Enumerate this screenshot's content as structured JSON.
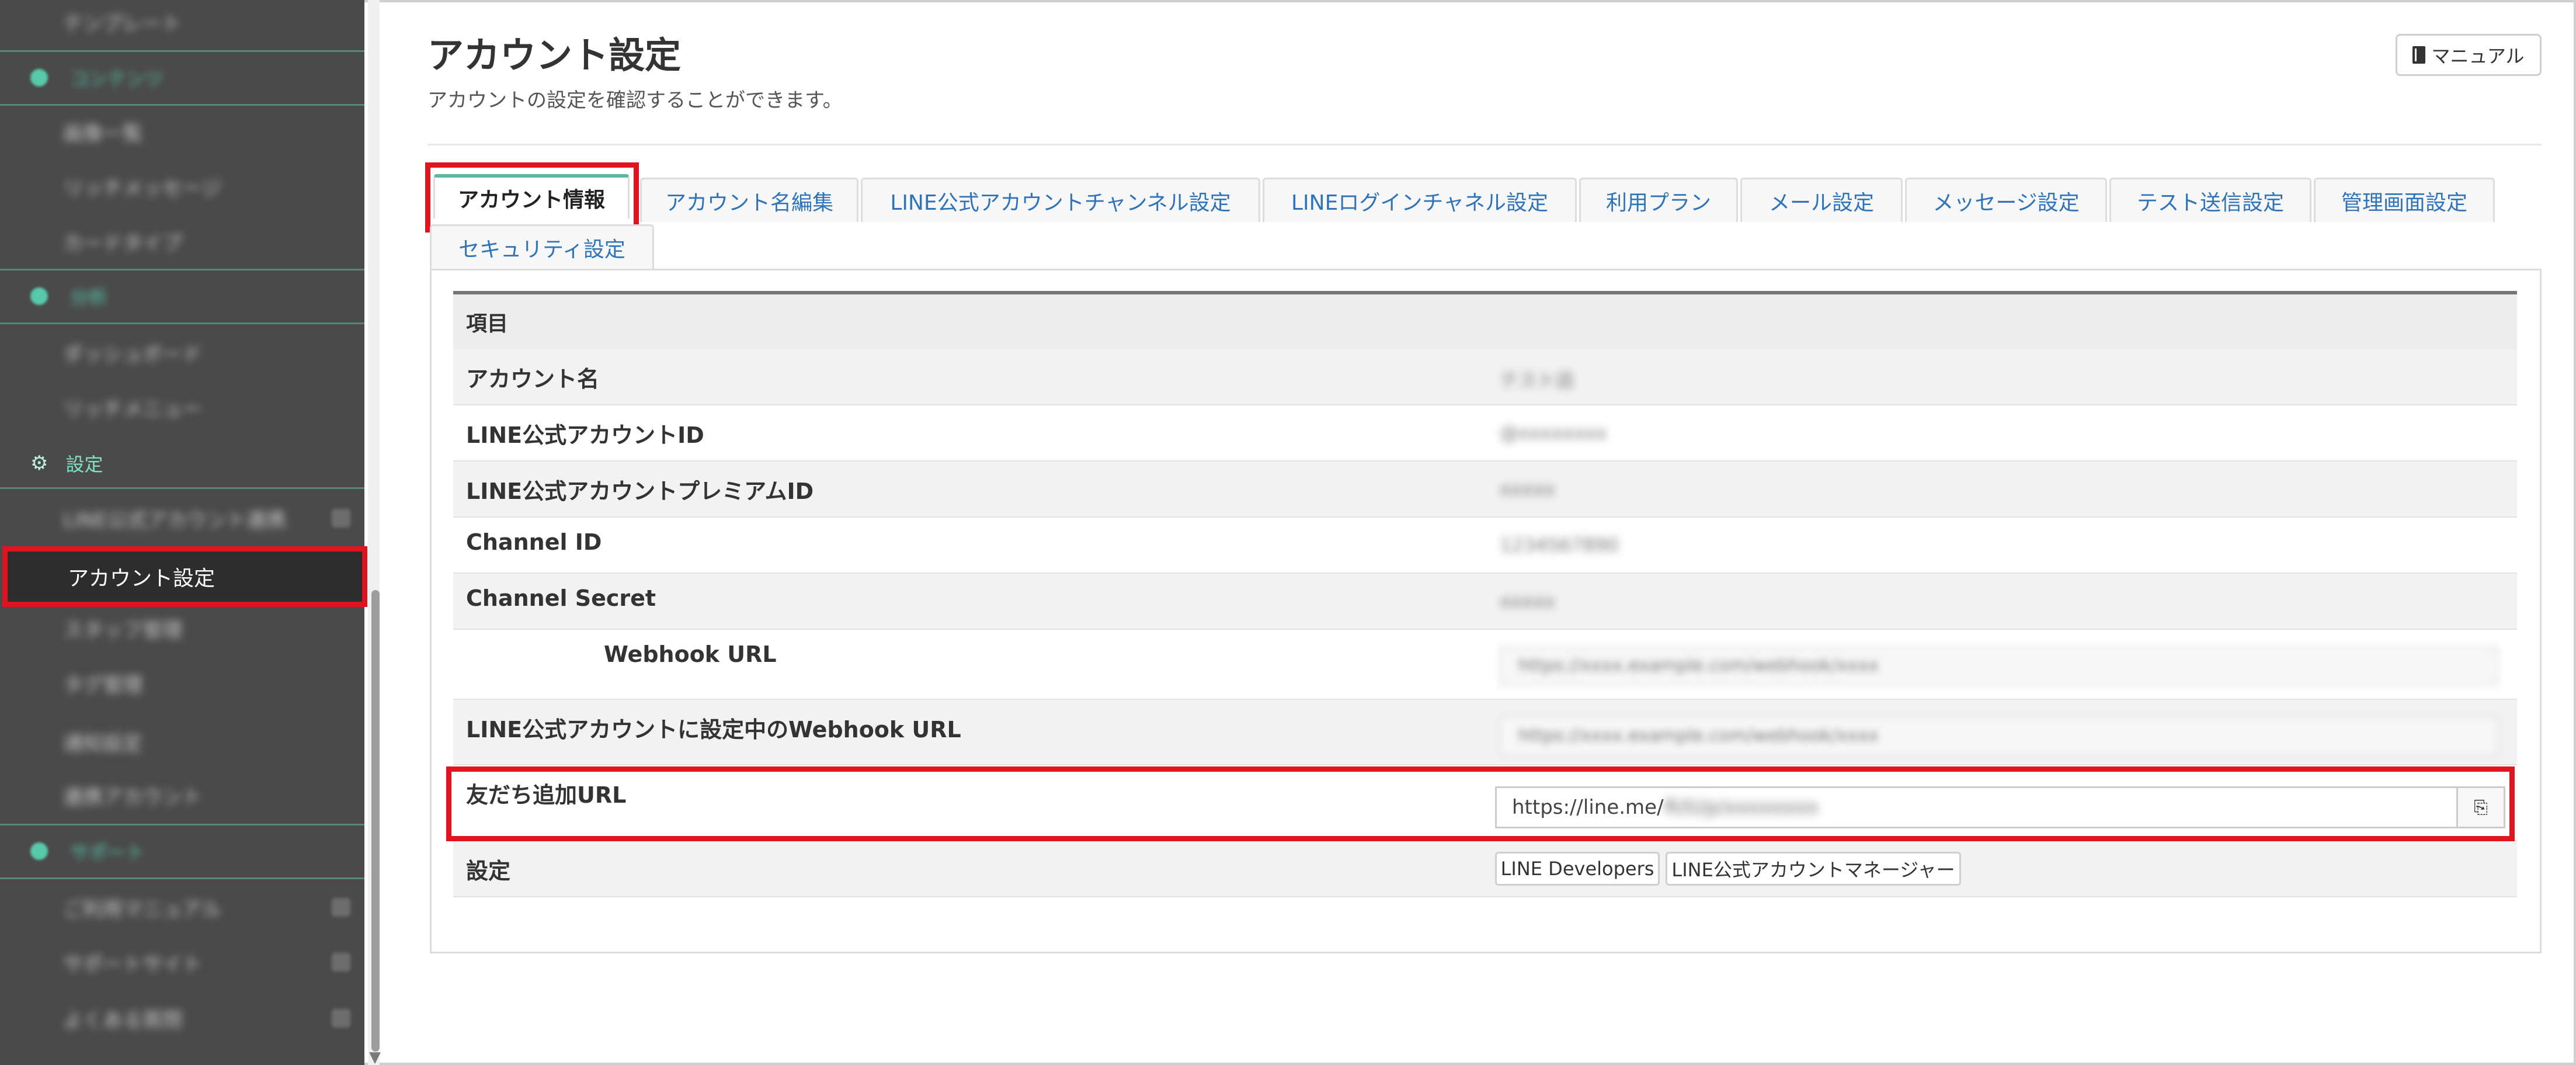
{
  "sidebar": {
    "items": [
      {
        "label": "テンプレート",
        "type": "item",
        "blurred": true
      },
      {
        "label": "コンテンツ",
        "type": "section",
        "blurred": true
      },
      {
        "label": "画像一覧",
        "type": "item",
        "blurred": true
      },
      {
        "label": "リッチメッセージ",
        "type": "item",
        "blurred": true
      },
      {
        "label": "カードタイプ",
        "type": "item",
        "blurred": true
      },
      {
        "label": "分析",
        "type": "section",
        "blurred": true
      },
      {
        "label": "ダッシュボード",
        "type": "item",
        "blurred": true
      },
      {
        "label": "リッチメニュー",
        "type": "item",
        "blurred": true
      },
      {
        "label": "設定",
        "type": "section",
        "blurred": false
      },
      {
        "label": "LINE公式アカウント連携",
        "type": "item",
        "blurred": true
      },
      {
        "label": "アカウント設定",
        "type": "item",
        "active": true,
        "blurred": false
      },
      {
        "label": "スタッフ管理",
        "type": "item",
        "blurred": true
      },
      {
        "label": "タグ管理",
        "type": "item",
        "blurred": true
      },
      {
        "label": "通知設定",
        "type": "item",
        "blurred": true
      },
      {
        "label": "連携アカウント",
        "type": "item",
        "blurred": true
      },
      {
        "label": "サポート",
        "type": "section",
        "blurred": true
      },
      {
        "label": "ご利用マニュアル",
        "type": "item",
        "blurred": true
      },
      {
        "label": "サポートサイト",
        "type": "item",
        "blurred": true
      },
      {
        "label": "よくある質問",
        "type": "item",
        "blurred": true
      }
    ]
  },
  "header": {
    "title": "アカウント設定",
    "subtitle": "アカウントの設定を確認することができます。",
    "manual_label": "マニュアル"
  },
  "tabs": [
    {
      "label": "アカウント情報",
      "active": true
    },
    {
      "label": "アカウント名編集"
    },
    {
      "label": "LINE公式アカウントチャンネル設定"
    },
    {
      "label": "LINEログインチャネル設定"
    },
    {
      "label": "利用プラン"
    },
    {
      "label": "メール設定"
    },
    {
      "label": "メッセージ設定"
    },
    {
      "label": "テスト送信設定"
    },
    {
      "label": "管理画面設定"
    },
    {
      "label": "セキュリティ設定"
    }
  ],
  "table": {
    "header": "項目",
    "rows": [
      {
        "label": "アカウント名",
        "value": "テスト店"
      },
      {
        "label": "LINE公式アカウントID",
        "value": "@xxxxxxxx"
      },
      {
        "label": "LINE公式アカウントプレミアムID",
        "value": "xxxxx"
      },
      {
        "label": "Channel ID",
        "value": "1234567890"
      },
      {
        "label": "Channel Secret",
        "value": "xxxxx"
      },
      {
        "label": "Webhook URL",
        "value": "https://xxxx.example.com/webhook/xxxx"
      },
      {
        "label": "LINE公式アカウントに設定中のWebhook URL",
        "value": "https://xxxx.example.com/webhook/xxxx"
      },
      {
        "label": "友だち追加URL",
        "value_prefix": "https://line.me/",
        "value_hidden": "R/ti/p/xxxxxxxx"
      },
      {
        "label": "設定"
      }
    ],
    "links": [
      "LINE Developers",
      "LINE公式アカウントマネージャー"
    ]
  },
  "colors": {
    "sidebar_bg": "#4a4a4a",
    "accent": "#59b9a0",
    "highlight": "#e0141e",
    "link": "#2f73b9"
  }
}
